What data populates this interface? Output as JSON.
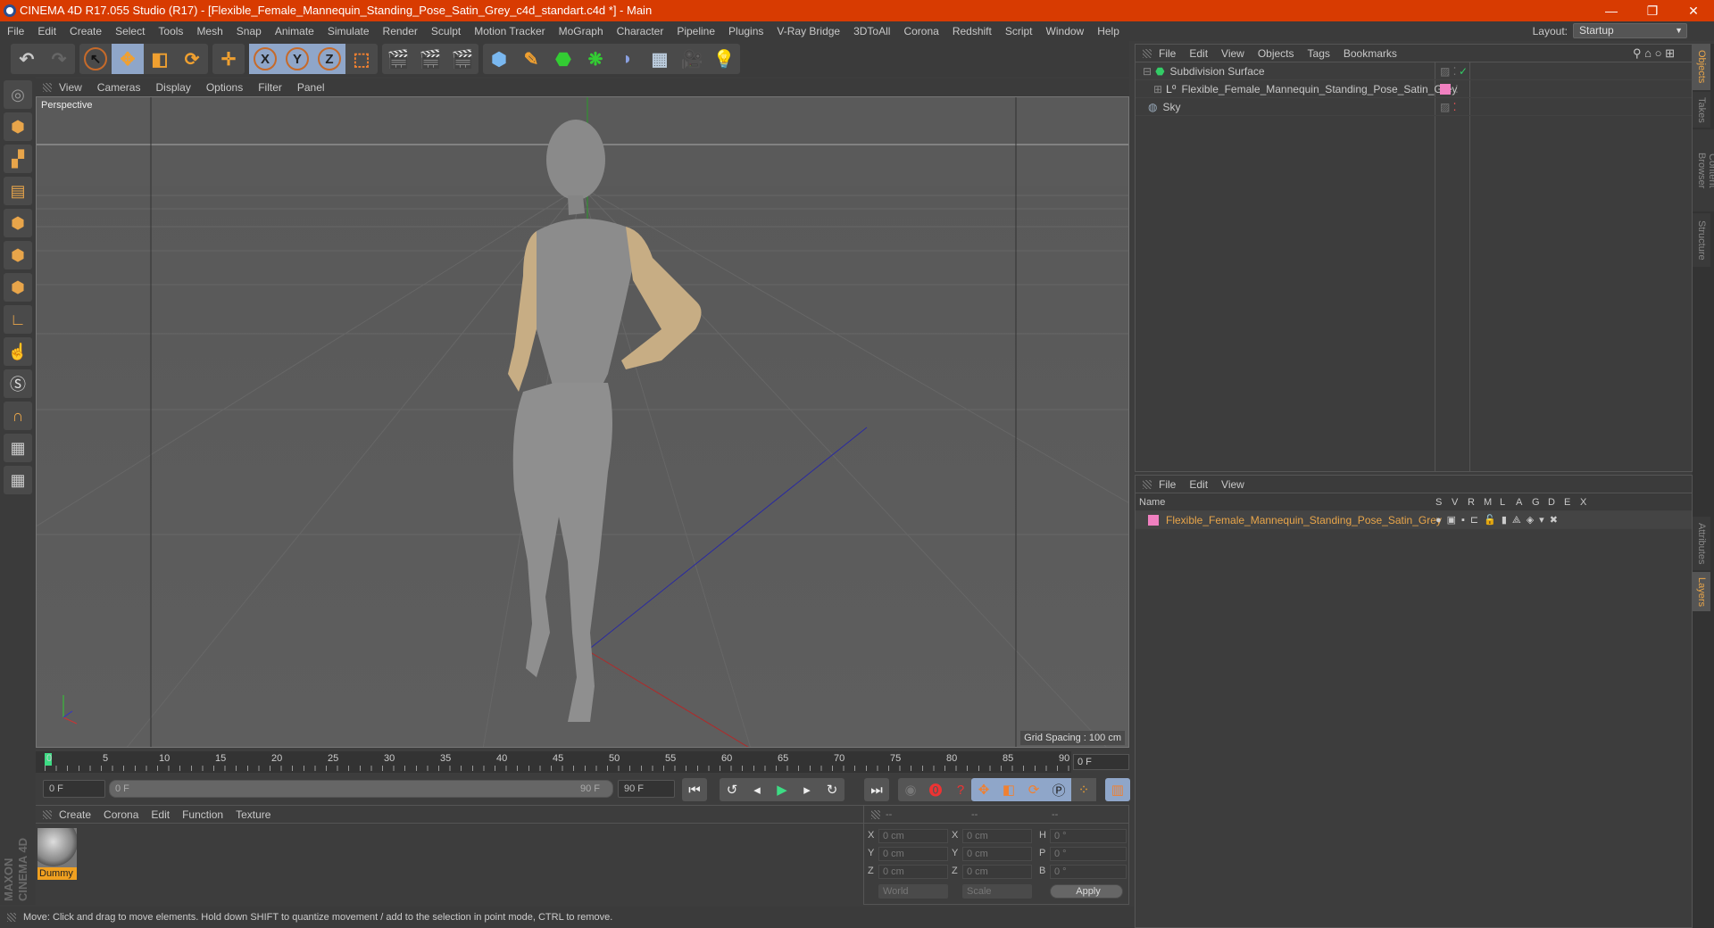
{
  "window": {
    "title": "CINEMA 4D R17.055 Studio (R17) - [Flexible_Female_Mannequin_Standing_Pose_Satin_Grey_c4d_standart.c4d *] - Main",
    "minimize": "—",
    "restore": "❐",
    "close": "✕"
  },
  "menu": [
    "File",
    "Edit",
    "Create",
    "Select",
    "Tools",
    "Mesh",
    "Snap",
    "Animate",
    "Simulate",
    "Render",
    "Sculpt",
    "Motion Tracker",
    "MoGraph",
    "Character",
    "Pipeline",
    "Plugins",
    "V-Ray Bridge",
    "3DToAll",
    "Corona",
    "Redshift",
    "Script",
    "Window",
    "Help"
  ],
  "layout": {
    "label": "Layout:",
    "value": "Startup"
  },
  "viewport": {
    "menu": [
      "View",
      "Cameras",
      "Display",
      "Options",
      "Filter",
      "Panel"
    ],
    "camera": "Perspective",
    "grid_spacing": "Grid Spacing : 100 cm"
  },
  "timeline": {
    "ticks": [
      "0",
      "5",
      "10",
      "15",
      "20",
      "25",
      "30",
      "35",
      "40",
      "45",
      "50",
      "55",
      "60",
      "65",
      "70",
      "75",
      "80",
      "85",
      "90"
    ],
    "current_frame": "0 F",
    "start": "0 F",
    "range_start": "0 F",
    "range_end": "90 F",
    "end": "90 F"
  },
  "materials": {
    "menu": [
      "Create",
      "Corona",
      "Edit",
      "Function",
      "Texture"
    ],
    "items": [
      {
        "name": "Dummy"
      }
    ]
  },
  "coords": {
    "headers": [
      "--",
      "--",
      "--"
    ],
    "rows": [
      {
        "a": "X",
        "av": "0 cm",
        "b": "X",
        "bv": "0 cm",
        "c": "H",
        "cv": "0 °"
      },
      {
        "a": "Y",
        "av": "0 cm",
        "b": "Y",
        "bv": "0 cm",
        "c": "P",
        "cv": "0 °"
      },
      {
        "a": "Z",
        "av": "0 cm",
        "b": "Z",
        "bv": "0 cm",
        "c": "B",
        "cv": "0 °"
      }
    ],
    "space": "World",
    "mode": "Scale",
    "apply": "Apply"
  },
  "status": "Move: Click and drag to move elements. Hold down SHIFT to quantize movement / add to the selection in point mode, CTRL to remove.",
  "objects": {
    "menu": [
      "File",
      "Edit",
      "View",
      "Objects",
      "Tags",
      "Bookmarks"
    ],
    "items": [
      {
        "name": "Subdivision Surface"
      },
      {
        "name": "Flexible_Female_Mannequin_Standing_Pose_Satin_Grey"
      },
      {
        "name": "Sky"
      }
    ]
  },
  "layers": {
    "menu": [
      "File",
      "Edit",
      "View"
    ],
    "name_header": "Name",
    "columns": [
      "S",
      "V",
      "R",
      "M",
      "L",
      "A",
      "G",
      "D",
      "E",
      "X"
    ],
    "items": [
      {
        "name": "Flexible_Female_Mannequin_Standing_Pose_Satin_Grey",
        "color": "#f080c0"
      }
    ]
  },
  "side_tabs": [
    "Objects",
    "Takes",
    "Content Browser",
    "Structure",
    "Attributes",
    "Layers"
  ],
  "brand": "MAXON CINEMA 4D",
  "colors": {
    "accent": "#d83b01",
    "highlight": "#e8a54a"
  }
}
